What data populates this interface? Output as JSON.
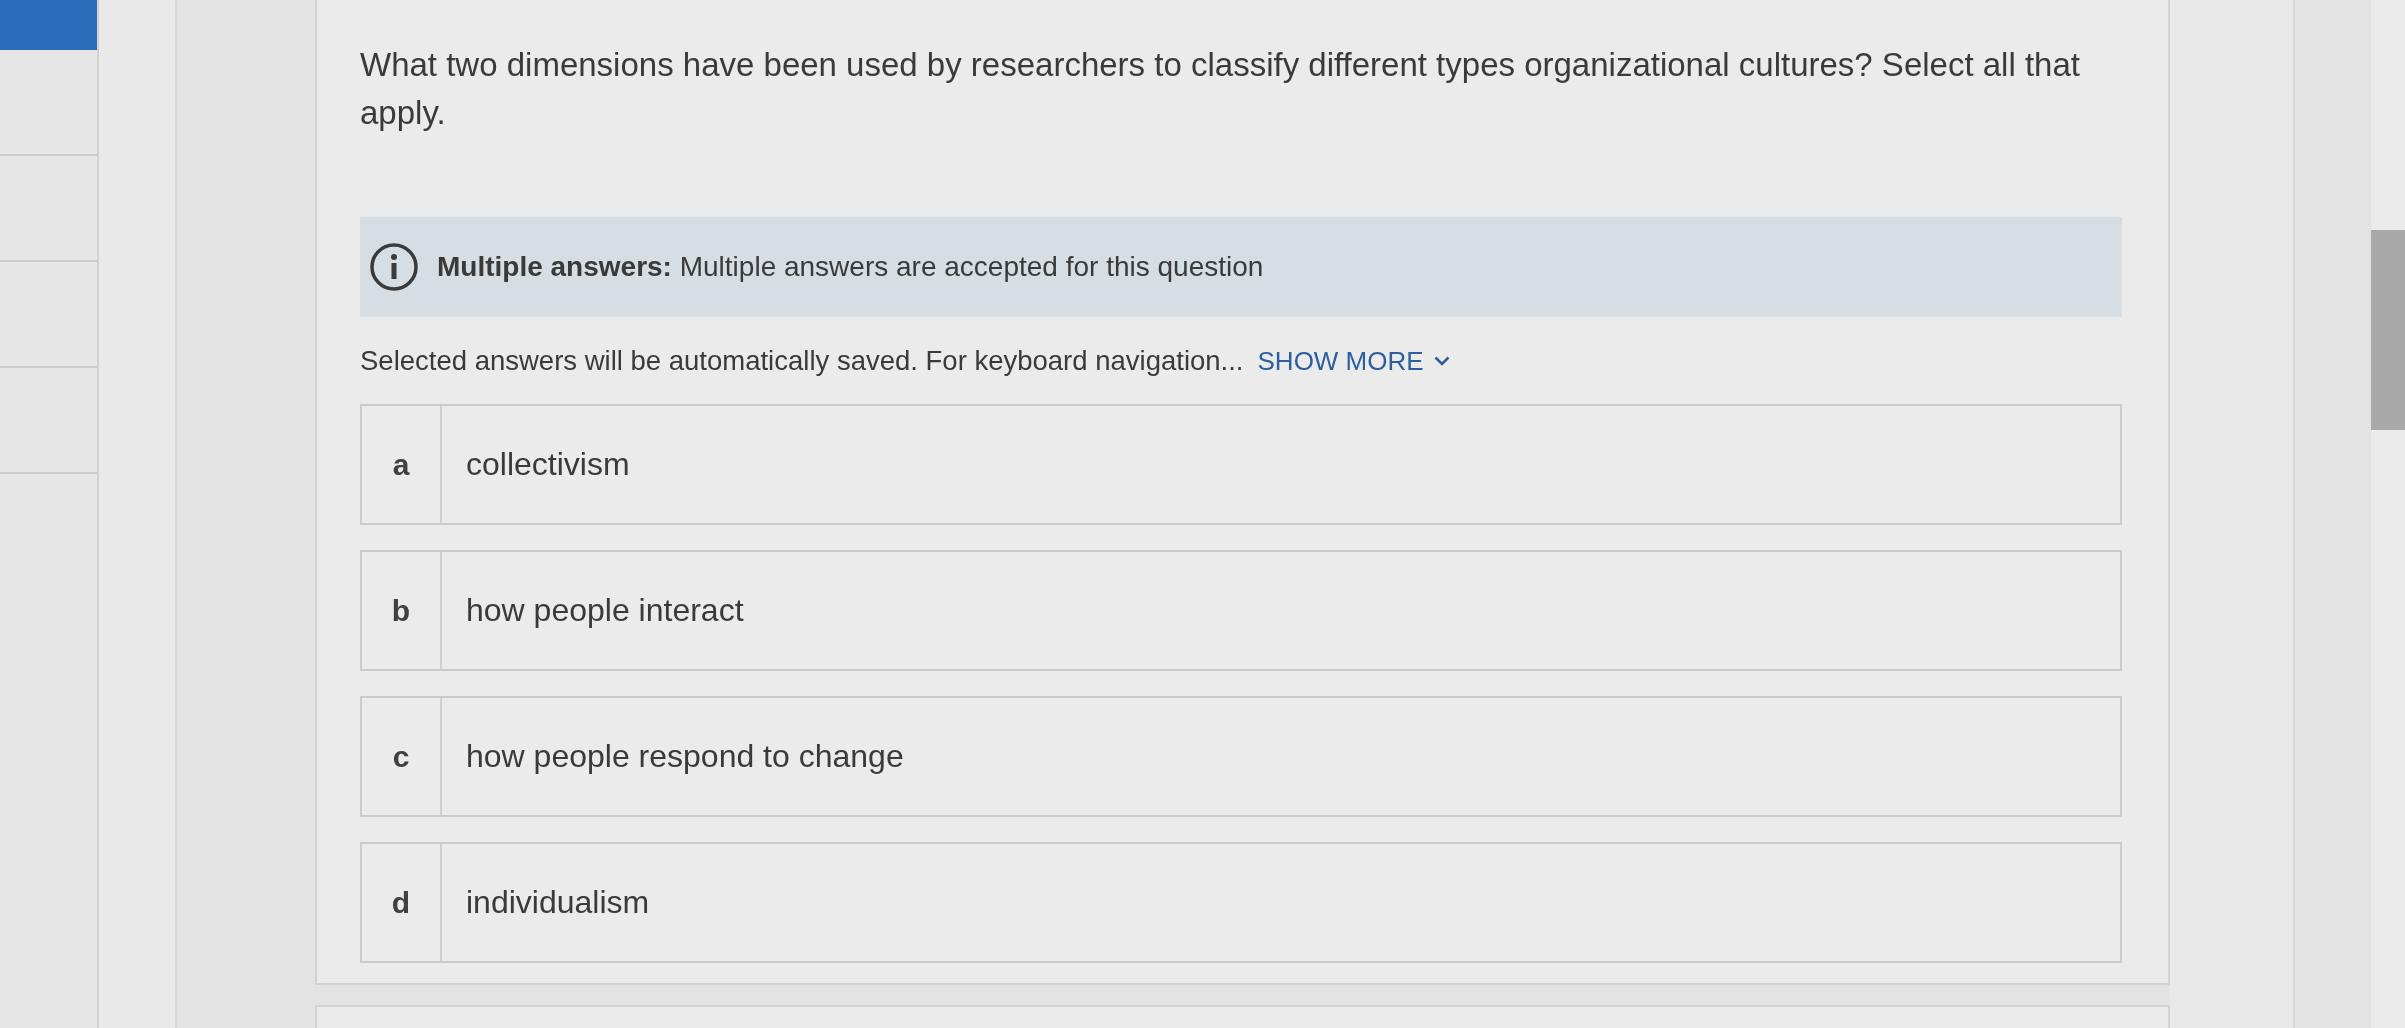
{
  "sidebar": {
    "items": [
      {
        "selected": true
      },
      {
        "selected": false
      },
      {
        "selected": false
      },
      {
        "selected": false
      },
      {
        "selected": false
      }
    ]
  },
  "question": {
    "text": "What two dimensions have been used by researchers to classify different types organizational cultures? Select all that apply."
  },
  "notice": {
    "text": "**Multiple answers:** Multiple answers are accepted for this question"
  },
  "instructions": {
    "text": "Selected answers will be automatically saved. For keyboard navigation...",
    "toggle": {
      "label": "SHOW MORE",
      "expanded": false
    }
  },
  "options": [
    {
      "letter": "a",
      "text": "collectivism",
      "selected": false
    },
    {
      "letter": "b",
      "text": "how people interact",
      "selected": false
    },
    {
      "letter": "c",
      "text": "how people respond to change",
      "selected": false
    },
    {
      "letter": "d",
      "text": "individualism",
      "selected": false
    }
  ]
}
